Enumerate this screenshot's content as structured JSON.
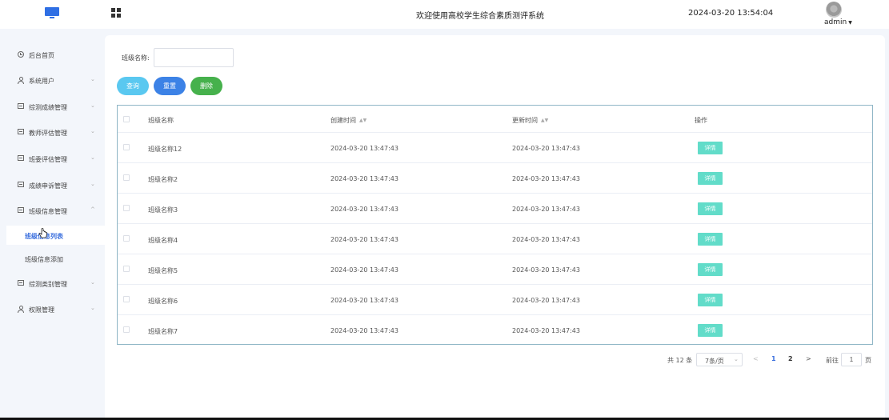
{
  "header": {
    "site_title": "欢迎使用高校学生综合素质测评系统",
    "datetime": "2024-03-20 13:54:04",
    "username": "admin",
    "icons": [
      "monitor-icon",
      "grid-menu-icon",
      "avatar"
    ]
  },
  "sidebar": {
    "items": [
      {
        "label": "后台首页",
        "icon": "clock-icon",
        "has_arrow": false
      },
      {
        "label": "系统用户",
        "icon": "user-icon",
        "has_arrow": true
      },
      {
        "label": "综测成绩管理",
        "icon": "box-icon",
        "has_arrow": true
      },
      {
        "label": "教师评估管理",
        "icon": "box-icon",
        "has_arrow": true
      },
      {
        "label": "班委评估管理",
        "icon": "box-icon",
        "has_arrow": true
      },
      {
        "label": "成绩申诉管理",
        "icon": "box-icon",
        "has_arrow": true
      },
      {
        "label": "班级信息管理",
        "icon": "box-icon",
        "has_arrow": true,
        "expanded": true
      },
      {
        "label": "综测类别管理",
        "icon": "box-icon",
        "has_arrow": true
      },
      {
        "label": "权限管理",
        "icon": "user-icon",
        "has_arrow": true
      }
    ],
    "sub_items": [
      {
        "label": "班级信息列表",
        "active": true
      },
      {
        "label": "班级信息添加",
        "active": false
      }
    ],
    "active_color": "#3a6fde"
  },
  "filter": {
    "label": "班级名称",
    "input_value": "",
    "input_placeholder": ""
  },
  "buttons": {
    "query": "查询",
    "reset": "重置",
    "delete": "删除"
  },
  "table": {
    "columns": [
      "班级名称",
      "创建时间",
      "更新时间",
      "操作"
    ],
    "rows": [
      {
        "name": "班级名称12",
        "created": "2024-03-20 13:47:43",
        "updated": "2024-03-20 13:47:43",
        "action": "详情"
      },
      {
        "name": "班级名称2",
        "created": "2024-03-20 13:47:43",
        "updated": "2024-03-20 13:47:43",
        "action": "详情"
      },
      {
        "name": "班级名称3",
        "created": "2024-03-20 13:47:43",
        "updated": "2024-03-20 13:47:43",
        "action": "详情"
      },
      {
        "name": "班级名称4",
        "created": "2024-03-20 13:47:43",
        "updated": "2024-03-20 13:47:43",
        "action": "详情"
      },
      {
        "name": "班级名称5",
        "created": "2024-03-20 13:47:43",
        "updated": "2024-03-20 13:47:43",
        "action": "详情"
      },
      {
        "name": "班级名称6",
        "created": "2024-03-20 13:47:43",
        "updated": "2024-03-20 13:47:43",
        "action": "详情"
      },
      {
        "name": "班级名称7",
        "created": "2024-03-20 13:47:43",
        "updated": "2024-03-20 13:47:43",
        "action": "详情"
      }
    ]
  },
  "pagination": {
    "total": "共 12 条",
    "page_size": "7条/页",
    "prev": "<",
    "pages": [
      "1",
      "2"
    ],
    "current": "1",
    "next": ">",
    "goto_label": "前往",
    "goto_value": "1",
    "page_suffix": "页"
  },
  "colors": {
    "query_btn": "#5ac8f0",
    "reset_btn": "#3c82e6",
    "delete_btn": "#46b14c",
    "detail_btn": "#62dcc9",
    "logo": "#2f6fe4"
  }
}
